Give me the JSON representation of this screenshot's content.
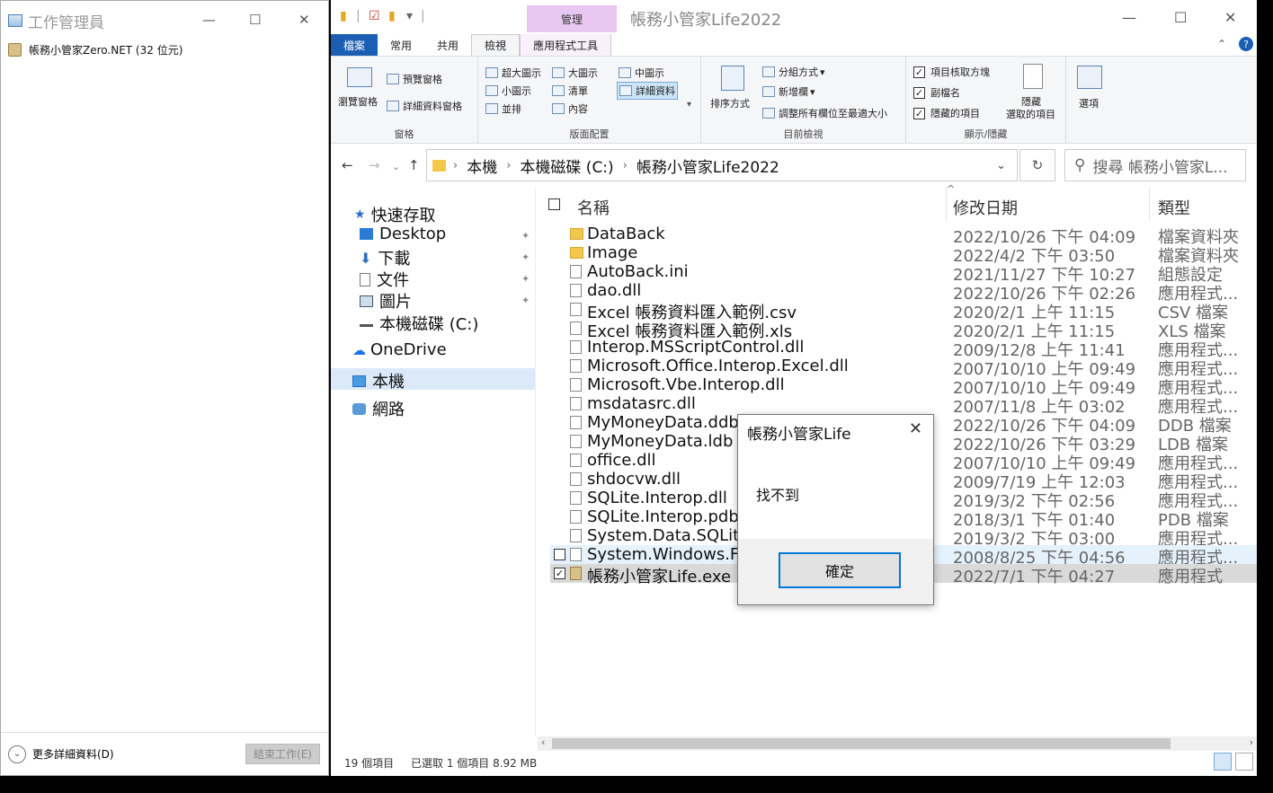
{
  "task_manager": {
    "title": "工作管理員",
    "process": "帳務小管家Zero.NET (32 位元)",
    "more_details": "更多詳細資料(D)",
    "end_task": "結束工作(E)"
  },
  "explorer": {
    "window_title": "帳務小管家Life2022",
    "manage_tab": "管理",
    "tabs": [
      "檔案",
      "常用",
      "共用",
      "檢視",
      "應用程式工具"
    ],
    "ribbon": {
      "pane": {
        "nav_pane": "瀏覽窗格",
        "preview": "預覽窗格",
        "details_pane": "詳細資料窗格",
        "label": "窗格"
      },
      "layout": {
        "items": [
          "超大圖示",
          "大圖示",
          "中圖示",
          "小圖示",
          "清單",
          "詳細資料",
          "並排",
          "內容"
        ],
        "label": "版面配置"
      },
      "current_view": {
        "sort": "排序方式",
        "group_by": "分組方式",
        "add_column": "新增欄",
        "fit_columns": "調整所有欄位至最適大小",
        "label": "目前檢視"
      },
      "show_hide": {
        "item_checkboxes": "項目核取方塊",
        "extensions": "副檔名",
        "hidden_items": "隱藏的項目",
        "hide_selected": "隱藏",
        "hide_selected_2": "選取的項目",
        "label": "顯示/隱藏"
      },
      "options": "選項"
    },
    "address": {
      "parts": [
        "本機",
        "本機磁碟 (C:)",
        "帳務小管家Life2022"
      ]
    },
    "search_placeholder": "搜尋 帳務小管家L...",
    "nav": {
      "quick_access": "快速存取",
      "desktop": "Desktop",
      "downloads": "下載",
      "documents": "文件",
      "pictures": "圖片",
      "local_disk": "本機磁碟 (C:)",
      "onedrive": "OneDrive",
      "this_pc": "本機",
      "network": "網路"
    },
    "columns": {
      "name": "名稱",
      "modified": "修改日期",
      "type": "類型"
    },
    "files": [
      {
        "name": "DataBack",
        "date": "2022/10/26 下午 04:09",
        "type": "檔案資料夾",
        "kind": "folder"
      },
      {
        "name": "Image",
        "date": "2022/4/2 下午 03:50",
        "type": "檔案資料夾",
        "kind": "folder"
      },
      {
        "name": "AutoBack.ini",
        "date": "2021/11/27 下午 10:27",
        "type": "組態設定",
        "kind": "file"
      },
      {
        "name": "dao.dll",
        "date": "2022/10/26 下午 02:26",
        "type": "應用程式...",
        "kind": "file"
      },
      {
        "name": "Excel 帳務資料匯入範例.csv",
        "date": "2020/2/1 上午 11:15",
        "type": "CSV 檔案",
        "kind": "file"
      },
      {
        "name": "Excel 帳務資料匯入範例.xls",
        "date": "2020/2/1 上午 11:15",
        "type": "XLS 檔案",
        "kind": "file"
      },
      {
        "name": "Interop.MSScriptControl.dll",
        "date": "2009/12/8 上午 11:41",
        "type": "應用程式...",
        "kind": "file"
      },
      {
        "name": "Microsoft.Office.Interop.Excel.dll",
        "date": "2007/10/10 上午 09:49",
        "type": "應用程式...",
        "kind": "file"
      },
      {
        "name": "Microsoft.Vbe.Interop.dll",
        "date": "2007/10/10 上午 09:49",
        "type": "應用程式...",
        "kind": "file"
      },
      {
        "name": "msdatasrc.dll",
        "date": "2007/11/8 上午 03:02",
        "type": "應用程式...",
        "kind": "file"
      },
      {
        "name": "MyMoneyData.ddb",
        "date": "2022/10/26 下午 04:09",
        "type": "DDB 檔案",
        "kind": "file"
      },
      {
        "name": "MyMoneyData.ldb",
        "date": "2022/10/26 下午 03:29",
        "type": "LDB 檔案",
        "kind": "file"
      },
      {
        "name": "office.dll",
        "date": "2007/10/10 上午 09:49",
        "type": "應用程式...",
        "kind": "file"
      },
      {
        "name": "shdocvw.dll",
        "date": "2009/7/19 上午 12:03",
        "type": "應用程式...",
        "kind": "file"
      },
      {
        "name": "SQLite.Interop.dll",
        "date": "2019/3/2 下午 02:56",
        "type": "應用程式...",
        "kind": "file"
      },
      {
        "name": "SQLite.Interop.pdb",
        "date": "2018/3/1 下午 01:40",
        "type": "PDB 檔案",
        "kind": "file"
      },
      {
        "name": "System.Data.SQLite.dll",
        "date": "2019/3/2 下午 03:00",
        "type": "應用程式...",
        "kind": "file"
      },
      {
        "name": "System.Windows.Forms.dll",
        "date": "2008/8/25 下午 04:56",
        "type": "應用程式...",
        "kind": "file"
      },
      {
        "name": "帳務小管家Life.exe",
        "date": "2022/7/1 下午 04:27",
        "type": "應用程式",
        "kind": "exe"
      }
    ],
    "status": {
      "count": "19 個項目",
      "selected": "已選取 1 個項目  8.92 MB"
    }
  },
  "dialog": {
    "title": "帳務小管家Life",
    "message": "找不到",
    "ok": "確定"
  }
}
